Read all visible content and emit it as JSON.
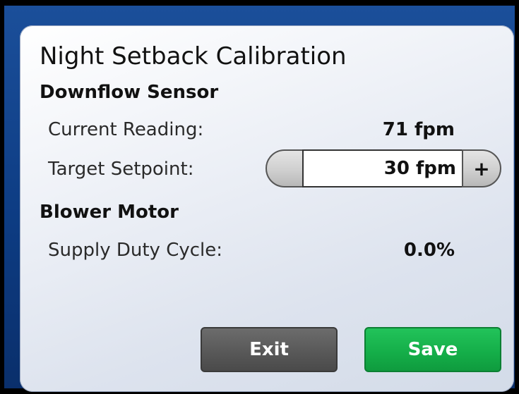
{
  "screen": {
    "title": "Night Setback Calibration"
  },
  "downflow": {
    "heading": "Downflow Sensor",
    "current_label": "Current Reading:",
    "current_value": "71 fpm",
    "target_label": "Target Setpoint:",
    "target_value": "30 fpm",
    "decrement_label": "",
    "increment_label": "+"
  },
  "blower": {
    "heading": "Blower Motor",
    "duty_label": "Supply Duty Cycle:",
    "duty_value": "0.0%"
  },
  "buttons": {
    "exit_label": "Exit",
    "save_label": "Save"
  },
  "colors": {
    "bezel": "#0d3c83",
    "exit": "#575757",
    "save": "#14ad48"
  }
}
